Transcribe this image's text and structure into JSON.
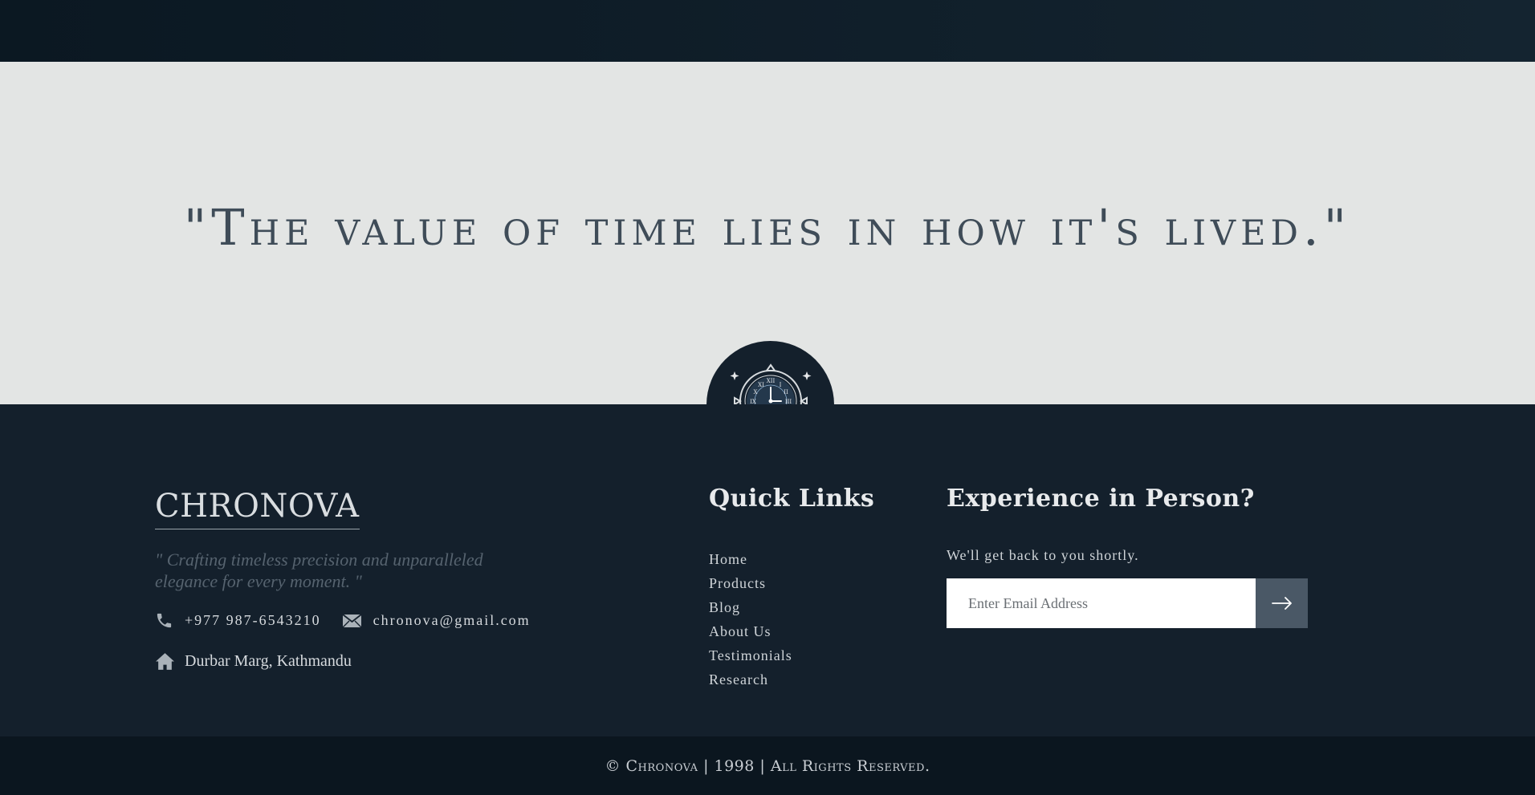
{
  "quote": {
    "text": "\"The value of time lies in how it's lived.\""
  },
  "footer": {
    "brand": "CHRONOVA",
    "tagline": "\" Crafting timeless precision and unparalleled elegance for every moment. \"",
    "phone": "+977 987-6543210",
    "email": "chronova@gmail.com",
    "address": "Durbar Marg, Kathmandu"
  },
  "quick_links": {
    "title": "Quick Links",
    "items": [
      "Home",
      "Products",
      "Blog",
      "About Us",
      "Testimonials",
      "Research"
    ]
  },
  "newsletter": {
    "title": "Experience in Person?",
    "subtitle": "We'll get back to you shortly.",
    "placeholder": "Enter Email Address"
  },
  "copyright": "© Chronova | 1998 | All Rights Reserved.",
  "colors": {
    "navy": "#14202c",
    "light_gray": "#e3e5e4",
    "button": "#4a5866"
  }
}
